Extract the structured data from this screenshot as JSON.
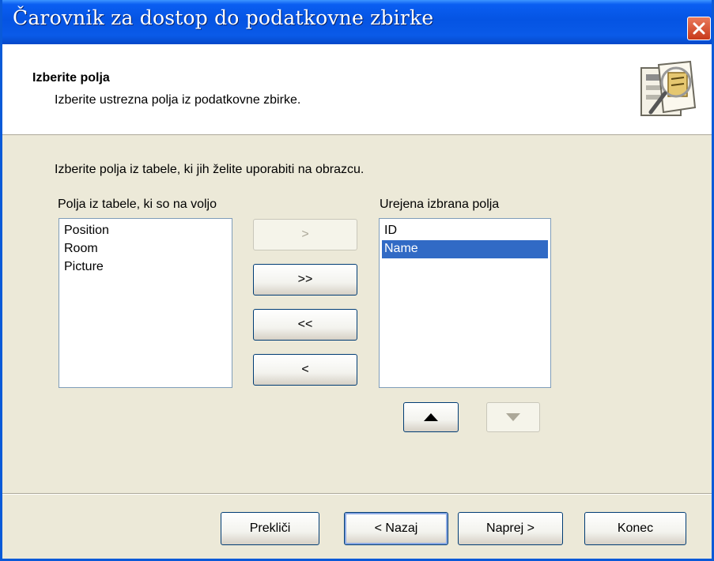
{
  "window": {
    "title": "Čarovnik za dostop do podatkovne zbirke"
  },
  "header": {
    "title": "Izberite polja",
    "subtitle": "Izberite ustrezna polja iz podatkovne zbirke."
  },
  "instructions": "Izberite polja iz tabele, ki jih želite uporabiti na obrazcu.",
  "available": {
    "label": "Polja iz tabele, ki so na voljo",
    "items": [
      "Position",
      "Room",
      "Picture"
    ]
  },
  "selected": {
    "label": "Urejena izbrana polja",
    "items": [
      "ID",
      "Name"
    ],
    "selected_item": "Name"
  },
  "move_buttons": {
    "add_one": ">",
    "add_all": ">>",
    "remove_all": "<<",
    "remove_one": "<"
  },
  "footer": {
    "cancel": "Prekliči",
    "back": "< Nazaj",
    "next": "Naprej >",
    "finish": "Konec"
  },
  "colors": {
    "titlebar": "#0554e3",
    "selection": "#316ac5",
    "dialog_bg": "#ece9d8"
  }
}
